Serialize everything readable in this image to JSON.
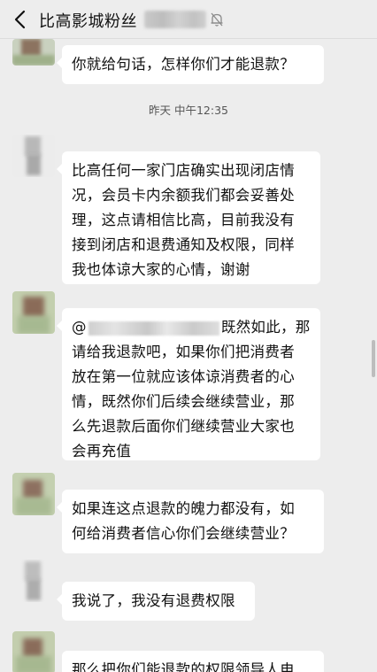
{
  "header": {
    "title": "比高影城粉丝",
    "back_icon": "back-chevron-icon",
    "mute_icon": "bell-muted-icon"
  },
  "timestamp": "昨天 中午12:35",
  "messages": [
    {
      "lines": [
        "你就给句话，怎样你们才能退款？"
      ]
    },
    {
      "lines": [
        "比高任何一家门店确实出现闭店情",
        "况，会员卡内余额我们都会妥善处",
        "理，这点请相信比高，目前我没有",
        "接到闭店和退费通知及权限，同样",
        "我也体谅大家的心情，谢谢"
      ]
    },
    {
      "mention_prefix": "@",
      "mention_suffix": "既然如此，那",
      "lines": [
        "请给我退款吧，如果你们把消费者",
        "放在第一位就应该体谅消费者的心",
        "情，既然你们后续会继续营业，那",
        "么先退款后面你们继续营业大家也",
        "会再充值"
      ]
    },
    {
      "lines": [
        "如果连这点退款的魄力都没有，如",
        "何给消费者信心你们会继续营业？"
      ]
    },
    {
      "lines": [
        "我说了，我没有退费权限"
      ]
    },
    {
      "lines": [
        "那么把你们能退款的权限领导人电"
      ]
    }
  ]
}
